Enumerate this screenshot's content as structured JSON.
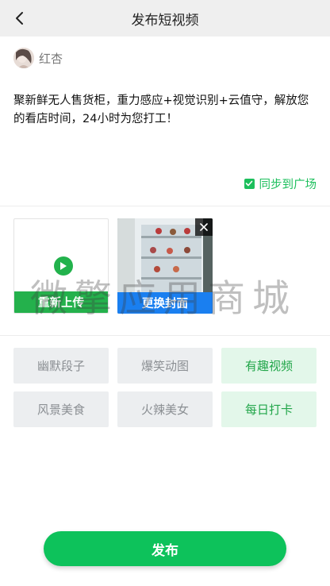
{
  "header": {
    "title": "发布短视频"
  },
  "user": {
    "name": "红杏"
  },
  "post": {
    "text": "聚新鲜无人售货柜，重力感应+视觉识别+云值守，解放您的看店时间，24小时为您打工！"
  },
  "sync": {
    "label": "同步到广场",
    "checked": true
  },
  "media": {
    "reupload_label": "重新上传",
    "change_cover_label": "更换封面"
  },
  "watermark": "微擎应用商城",
  "tags": [
    {
      "label": "幽默段子",
      "selected": false
    },
    {
      "label": "爆笑动图",
      "selected": false
    },
    {
      "label": "有趣视频",
      "selected": true
    },
    {
      "label": "风景美食",
      "selected": false
    },
    {
      "label": "火辣美女",
      "selected": false
    },
    {
      "label": "每日打卡",
      "selected": true
    }
  ],
  "actions": {
    "publish_label": "发布"
  },
  "colors": {
    "accent": "#0dc25b",
    "reupload": "#24b14c",
    "cover": "#1a7ff0",
    "tag_selected_bg": "#e3f7ea",
    "tag_selected_text": "#22a64a"
  },
  "icons": {
    "back": "chevron-left-icon",
    "play": "play-icon",
    "close": "close-icon",
    "check": "check-icon"
  }
}
